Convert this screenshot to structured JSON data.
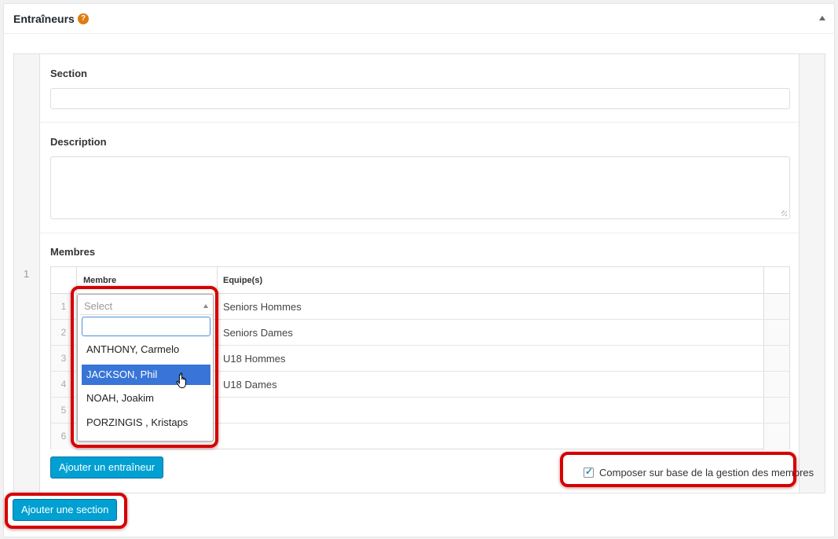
{
  "panel": {
    "title": "Entraîneurs",
    "help_icon_glyph": "?",
    "accent_color": "#e07a10"
  },
  "repeater": {
    "row_number": "1",
    "section_label": "Section",
    "section_value": "",
    "description_label": "Description",
    "description_value": "",
    "members_label": "Membres",
    "table": {
      "headers": [
        "Membre",
        "Equipe(s)"
      ],
      "rows": [
        {
          "num": "1",
          "equipe": "Seniors Hommes"
        },
        {
          "num": "2",
          "equipe": "Seniors Dames"
        },
        {
          "num": "3",
          "equipe": "U18 Hommes"
        },
        {
          "num": "4",
          "equipe": "U18 Dames"
        },
        {
          "num": "5",
          "equipe": ""
        },
        {
          "num": "6",
          "equipe": ""
        }
      ]
    },
    "add_coach_button": "Ajouter un entraîneur",
    "compose_checkbox": {
      "label": "Composer sur base de la gestion des membres",
      "checked": true
    }
  },
  "dropdown": {
    "placeholder": "Select",
    "search_value": "",
    "options": [
      "ANTHONY, Carmelo",
      "JACKSON, Phil",
      "NOAH, Joakim",
      "PORZINGIS , Kristaps"
    ],
    "highlighted_option": "JACKSON, Phil"
  },
  "add_section_button": "Ajouter une section",
  "colors": {
    "button": "#00a0d2",
    "highlight_ring": "#d60000",
    "selected_option": "#3875d7"
  }
}
